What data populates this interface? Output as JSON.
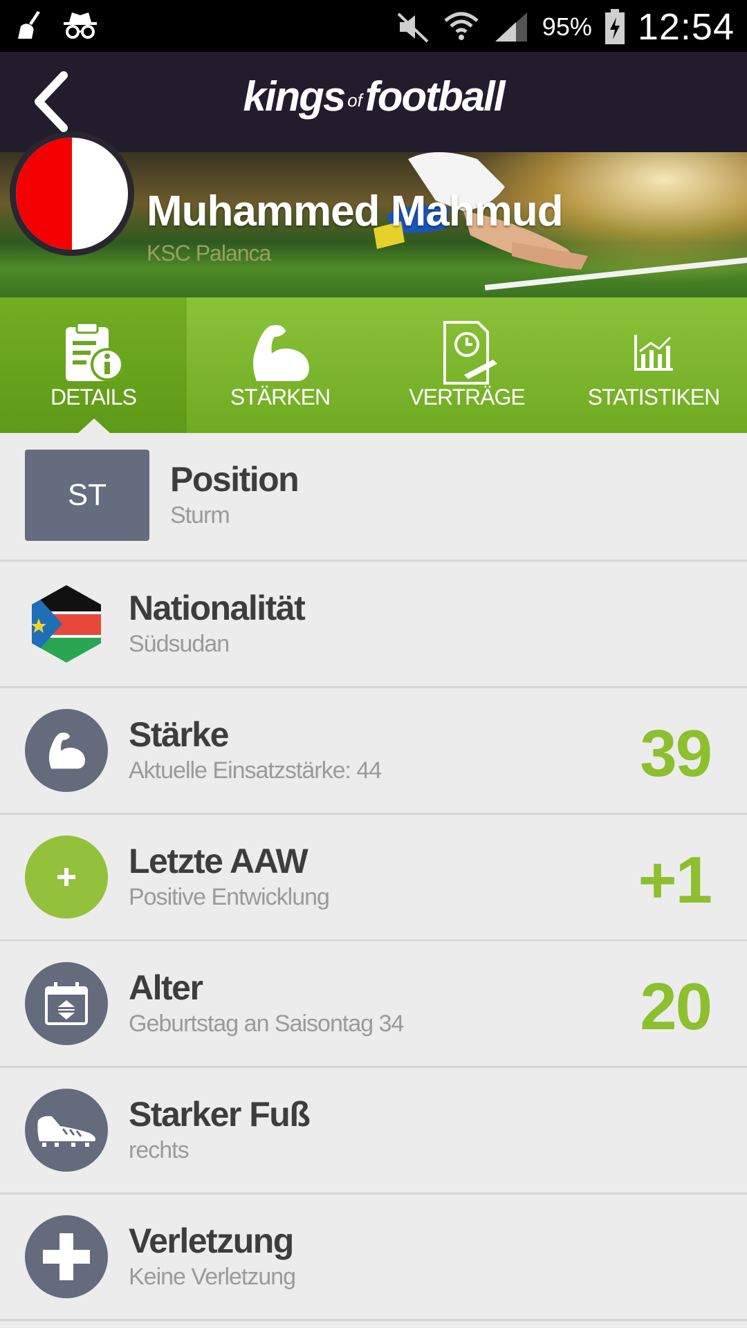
{
  "status_bar": {
    "battery_percent": "95%",
    "time": "12:54",
    "icons": [
      "cleaner-icon",
      "incognito-icon",
      "mute-icon",
      "wifi-icon",
      "signal-icon",
      "battery-charging-icon"
    ]
  },
  "header": {
    "logo_part1": "kings",
    "logo_part2": "of",
    "logo_part3": "football"
  },
  "player": {
    "name": "Muhammed Mahmud",
    "club": "KSC Palanca"
  },
  "tabs": [
    {
      "label": "DETAILS",
      "icon": "clipboard-info-icon",
      "active": true
    },
    {
      "label": "STÄRKEN",
      "icon": "flexed-arm-icon",
      "active": false
    },
    {
      "label": "VERTRÄGE",
      "icon": "contract-clock-icon",
      "active": false
    },
    {
      "label": "STATISTIKEN",
      "icon": "bar-chart-icon",
      "active": false
    }
  ],
  "details": {
    "position": {
      "badge": "ST",
      "title": "Position",
      "sub": "Sturm"
    },
    "nationality": {
      "title": "Nationalität",
      "sub": "Südsudan",
      "icon": "south-sudan-flag-icon"
    },
    "strength": {
      "title": "Stärke",
      "sub": "Aktuelle Einsatzstärke: 44",
      "value": "39",
      "icon": "flexed-arm-icon"
    },
    "last_aaw": {
      "title": "Letzte AAW",
      "sub": "Positive Entwicklung",
      "value": "+1",
      "icon": "plus-icon"
    },
    "age": {
      "title": "Alter",
      "sub": "Geburtstag an Saisontag 34",
      "value": "20",
      "icon": "calendar-icon"
    },
    "strong_foot": {
      "title": "Starker Fuß",
      "sub": "rechts",
      "icon": "football-boot-icon"
    },
    "injury": {
      "title": "Verletzung",
      "sub": "Keine Verletzung",
      "icon": "medical-cross-icon"
    }
  },
  "colors": {
    "accent_green": "#8dbf2e",
    "header_bg": "#221d2c",
    "icon_gray": "#636b7c"
  }
}
